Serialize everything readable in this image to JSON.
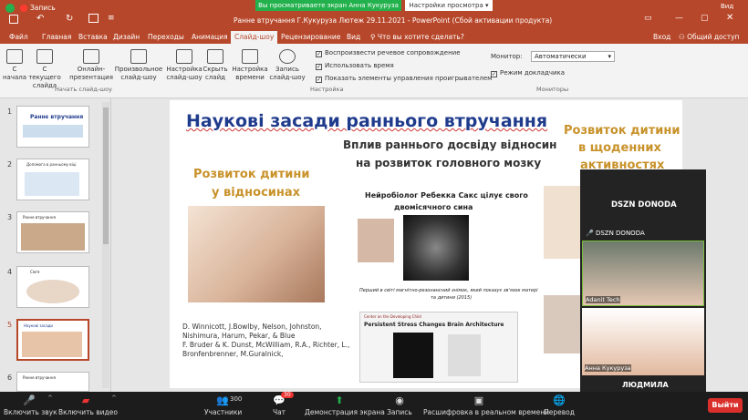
{
  "title": {
    "recording": "Запись",
    "sharing_banner": "Вы просматриваете экран Анна Кукуруза",
    "view_settings": "Настройки просмотра",
    "doc_title": "Ранне втручання Г.Кукуруза Лютеж 29.11.2021 - PowerPoint (Сбой активации продукта)",
    "view_label": "Вид"
  },
  "tabs": [
    "Файл",
    "Главная",
    "Вставка",
    "Дизайн",
    "Переходы",
    "Анимация",
    "Слайд-шоу",
    "Рецензирование",
    "Вид"
  ],
  "tell_me": "Что вы хотите сделать?",
  "sign_in": "Вход",
  "share": "Общий доступ",
  "ribbon": {
    "buttons": [
      "С начала",
      "С текущего слайда",
      "Онлайн-презентация",
      "Произвольное слайд-шоу",
      "Настройка слайд-шоу",
      "Скрыть слайд",
      "Настройка времени",
      "Запись слайд-шоу"
    ],
    "group_start": "Начать слайд-шоу",
    "group_settings": "Настройка",
    "group_monitors": "Мониторы",
    "checks": [
      "Воспроизвести речевое сопровождение",
      "Использовать время",
      "Показать элементы управления проигрывателем"
    ],
    "monitor_label": "Монитор:",
    "monitor_value": "Автоматически",
    "presenter_view": "Режим докладчика"
  },
  "thumbnails": [
    {
      "num": "1",
      "caption": "Раннє втручання"
    },
    {
      "num": "2",
      "caption": "Допомога в ранньому віці"
    },
    {
      "num": "3",
      "caption": "Ранне втручання"
    },
    {
      "num": "4",
      "caption": "Сім'я"
    },
    {
      "num": "5",
      "caption": "Наукові засади"
    },
    {
      "num": "6",
      "caption": "Ранне втручання"
    }
  ],
  "slide": {
    "title": "Наукові засади раннього втручання",
    "subtitle_line1": "Вплив раннього досвіду відносин",
    "subtitle_line2": "на розвиток головного мозку",
    "left_heading_line1": "Розвиток дитини",
    "left_heading_line2": "у відносинах",
    "right_heading_line1": "Розвиток дитини",
    "right_heading_line2": "в щоденних",
    "right_heading_line3": "активностях",
    "neuro_line1": "Нейробіолог Ребекка Сакс цілує свого",
    "neuro_line2": "двомісячного сина",
    "caption_line1": "Перший в світі магнітно-резонансний знімок, який показує зв'язок матері",
    "caption_line2": "та дитини (2015)",
    "refs_line1": "D. Winnicott, J.Bowlby, Nelson, Johnston,",
    "refs_line2": "Nishimura, Harum, Pekar, & Blue",
    "refs_line3": "F. Bruder & K. Dunst, McWilliam, R.A., Richter, L.,",
    "refs_line4": "Bronfenbrenner, M.Guralnick,",
    "stress_header": "Center on the Developing Child",
    "stress_title": "Persistent Stress Changes Brain Architecture"
  },
  "participants": {
    "speaker": "DSZN DONODA",
    "gallery_label": "DSZN DONODA",
    "p1": "Adanit Tech",
    "p2": "Анна Кукуруза",
    "p3": "ЛЮДМИЛА"
  },
  "bottom": {
    "mute": "Включить звук",
    "video": "Включить видео",
    "participants_count": "300",
    "participants": "Участники",
    "chat_badge": "30",
    "chat": "Чат",
    "share_screen": "Демонстрация экрана",
    "record": "Запись",
    "cc": "Расшифровка в реальном времени",
    "translate": "Перевод",
    "leave": "Выйти"
  },
  "colors": {
    "accent": "#b7472a",
    "title_blue": "#1f3b8c",
    "heading_gold": "#c8922a",
    "zoom_green": "#22b14c",
    "leave_red": "#d9302c"
  }
}
